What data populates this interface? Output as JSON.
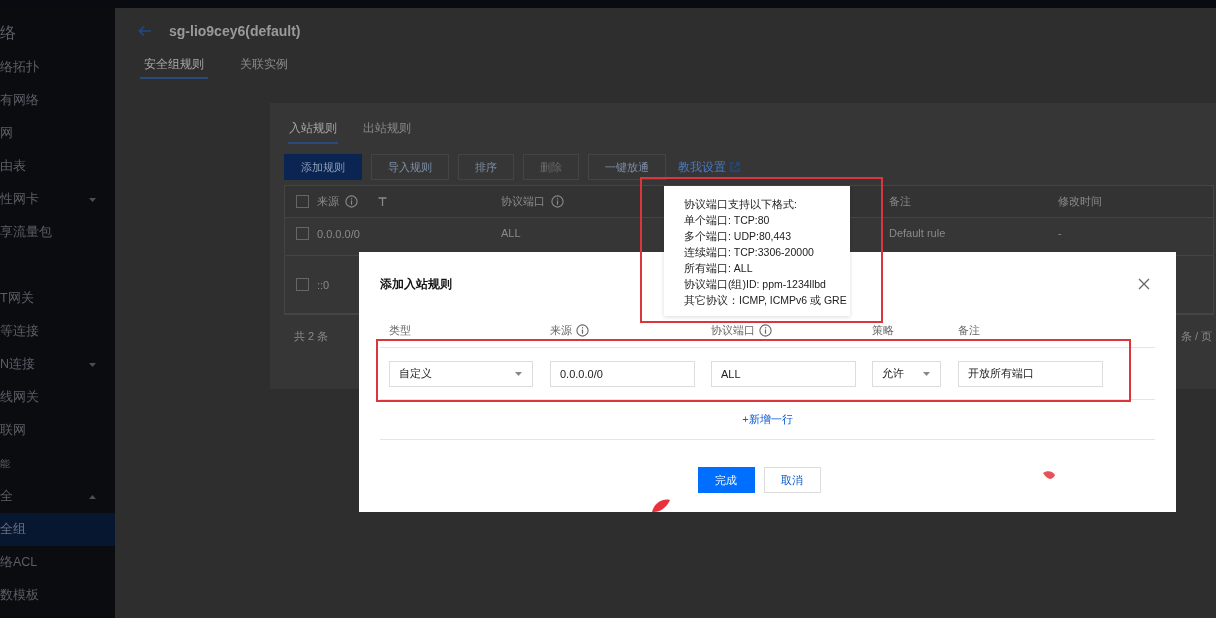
{
  "sidebar": {
    "title": "络",
    "items": [
      {
        "label": "络拓扑",
        "selected": false
      },
      {
        "label": "有网络",
        "selected": false
      },
      {
        "label": "网",
        "selected": false
      },
      {
        "label": "由表",
        "selected": false
      },
      {
        "label": "性网卡",
        "selected": false,
        "expanded": false
      },
      {
        "label": "享流量包",
        "selected": false
      },
      {
        "label": "T网关",
        "selected": false
      },
      {
        "label": "等连接",
        "selected": false
      },
      {
        "label": "N连接",
        "selected": false,
        "expanded": false
      },
      {
        "label": "线网关",
        "selected": false
      },
      {
        "label": "联网",
        "selected": false
      },
      {
        "label": "能",
        "selected": false,
        "kind": "group"
      },
      {
        "label": "全",
        "selected": false,
        "expanded": true
      },
      {
        "label": "全组",
        "selected": true
      },
      {
        "label": "络ACL",
        "selected": false
      },
      {
        "label": "数模板",
        "selected": false
      }
    ]
  },
  "page": {
    "title": "sg-lio9cey6(default)",
    "tabs": [
      {
        "label": "安全组规则",
        "selected": true
      },
      {
        "label": "关联实例",
        "selected": false
      }
    ]
  },
  "card": {
    "tabs": [
      {
        "label": "入站规则",
        "selected": true
      },
      {
        "label": "出站规则",
        "selected": false
      }
    ],
    "toolbar": [
      {
        "label": "添加规则",
        "kind": "primary",
        "disabled": false
      },
      {
        "label": "导入规则",
        "kind": "default",
        "disabled": false
      },
      {
        "label": "排序",
        "kind": "default",
        "disabled": false
      },
      {
        "label": "删除",
        "kind": "default",
        "disabled": true
      },
      {
        "label": "一键放通",
        "kind": "default",
        "disabled": false
      },
      {
        "label": "教我设置",
        "kind": "link",
        "disabled": false
      }
    ],
    "table": {
      "checked": false,
      "columns": [
        {
          "label": "来源",
          "info": true,
          "filter": true
        },
        {
          "label": "协议端口",
          "info": true
        },
        {
          "label": "备注"
        },
        {
          "label": "修改时间"
        }
      ],
      "rows": [
        {
          "checked": false,
          "cells": [
            "0.0.0.0/0",
            "ALL",
            "Default rule",
            "-"
          ]
        },
        {
          "checked": false,
          "cells": [
            "::0"
          ]
        }
      ]
    },
    "total": "共 2 条",
    "page_size": "条 / 页"
  },
  "modal": {
    "title": "添加入站规则",
    "columns": [
      {
        "label": "类型"
      },
      {
        "label": "来源",
        "info": true
      },
      {
        "label": "协议端口",
        "info": true
      },
      {
        "label": "策略"
      },
      {
        "label": "备注"
      }
    ],
    "fields": [
      {
        "kind": "select",
        "value": "自定义"
      },
      {
        "kind": "input",
        "value": "0.0.0.0/0"
      },
      {
        "kind": "input",
        "value": "ALL"
      },
      {
        "kind": "select",
        "value": "允许"
      },
      {
        "kind": "input",
        "value": "开放所有端口"
      }
    ],
    "add_row": "+新增一行",
    "buttons": [
      {
        "label": "完成",
        "kind": "primary"
      },
      {
        "label": "取消",
        "kind": "default"
      }
    ]
  },
  "tooltip": {
    "lines": [
      "协议端口支持以下格式:",
      "单个端口: TCP:80",
      "多个端口: UDP:80,443",
      "连续端口: TCP:3306-20000",
      "所有端口: ALL",
      "协议端口(组)ID: ppm-1234llbd",
      "其它协议：ICMP, ICMPv6 或 GRE"
    ]
  }
}
